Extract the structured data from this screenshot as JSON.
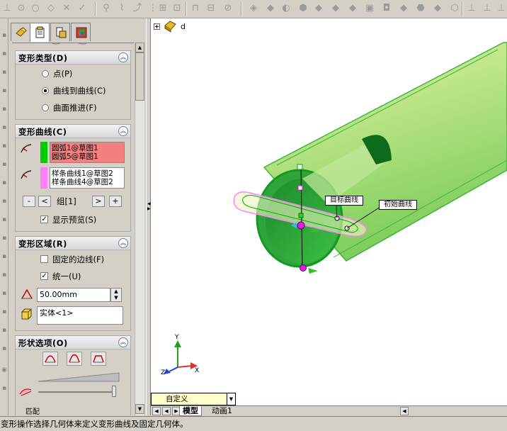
{
  "toolbar": {
    "icons": [
      "sketch-icon",
      "smart-dimension-icon",
      "line-icon",
      "circle-icon",
      "arc-icon",
      "rectangle-icon",
      "spline-icon",
      "trim-icon",
      "offset-icon",
      "mirror-icon",
      "grid-icon",
      "point-icon",
      "extrude-icon",
      "revolve-icon",
      "sweep-icon",
      "loft-icon",
      "fillet-icon",
      "chamfer-icon",
      "shell-icon",
      "rib-icon",
      "draft-icon",
      "hole-icon",
      "pattern-icon",
      "deform-icon",
      "view-icon",
      "zoom-icon"
    ]
  },
  "panel": {
    "tabs": [
      "featuremanager-tab",
      "propertymanager-tab",
      "configurationmanager-tab",
      "dimxpert-tab"
    ],
    "deform_type": {
      "title": "变形类型(D)",
      "options": [
        {
          "label": "点(P)",
          "selected": false
        },
        {
          "label": "曲线到曲线(C)",
          "selected": true
        },
        {
          "label": "曲面推进(F)",
          "selected": false
        }
      ]
    },
    "deform_curves": {
      "title": "变形曲线(C)",
      "initial_curves": [
        "圆弧1@草图1",
        "圆弧5@草图1"
      ],
      "target_curves": [
        "样条曲线1@草图2",
        "样条曲线4@草图2"
      ],
      "initial_color": "#00cc00",
      "target_color": "#ff80ff",
      "btn_minus": "-",
      "btn_prev": "<",
      "group_label": "组[1]",
      "btn_next": ">",
      "btn_plus": "+",
      "show_preview_label": "显示预览(S)",
      "show_preview_checked": true
    },
    "deform_region": {
      "title": "变形区域(R)",
      "fixed_edges_label": "固定的边线(F)",
      "fixed_edges_checked": false,
      "uniform_label": "统一(U)",
      "uniform_checked": true,
      "radius_value": "50.00mm",
      "body_value": "实体<1>"
    },
    "shape_options": {
      "title": "形状选项(O)",
      "match_label": "匹配"
    }
  },
  "viewport": {
    "tree_root_label": "d",
    "target_curve_label": "目标曲线",
    "initial_curve_label": "初始曲线",
    "triad": {
      "x": "X",
      "y": "Y",
      "z": "Z"
    },
    "tube_color": "#3cb43c",
    "tube_face_color": "#c8eb8c"
  },
  "config_box": {
    "value": "自定义"
  },
  "bottom_tabs": [
    {
      "label": "模型",
      "active": true
    },
    {
      "label": "动画1",
      "active": false
    }
  ],
  "status": {
    "text": "变形操作选择几何体来定义变形曲线及固定几何体。"
  }
}
